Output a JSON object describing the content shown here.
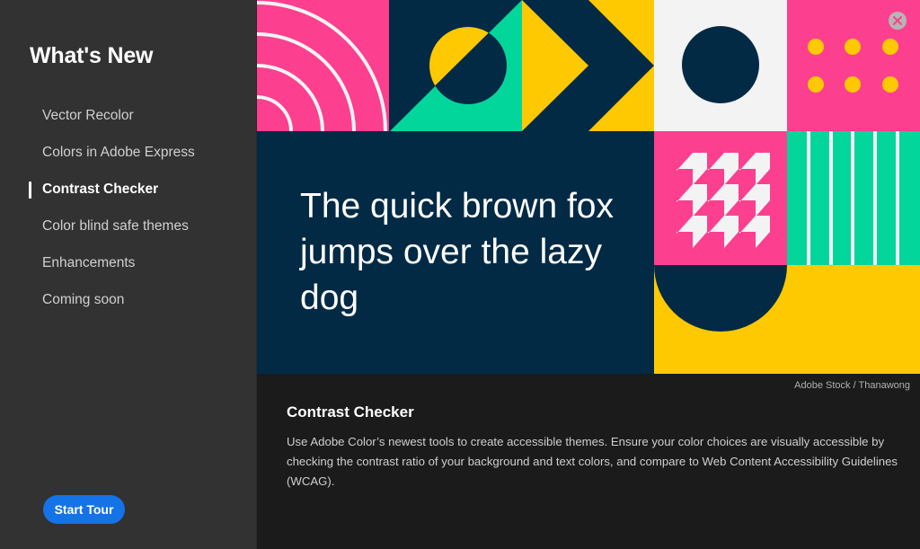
{
  "sidebar": {
    "title": "What's New",
    "items": [
      {
        "label": "Vector Recolor",
        "active": false
      },
      {
        "label": "Colors in Adobe Express",
        "active": false
      },
      {
        "label": "Contrast Checker",
        "active": true
      },
      {
        "label": "Color blind safe themes",
        "active": false
      },
      {
        "label": "Enhancements",
        "active": false
      },
      {
        "label": "Coming soon",
        "active": false
      }
    ],
    "start_tour_label": "Start Tour"
  },
  "hero": {
    "sample_text": "The quick brown fox jumps over the lazy dog",
    "credit": "Adobe Stock / Thanawong",
    "close_icon": "close-icon",
    "colors": {
      "navy": "#032a45",
      "pink": "#fd3f8f",
      "teal": "#03d69b",
      "yellow": "#fec901",
      "white": "#f3f3f3"
    }
  },
  "content": {
    "title": "Contrast Checker",
    "body": "Use Adobe Color’s newest tools to create accessible themes. Ensure your color choices are visually accessible by checking the contrast ratio of your background and text colors, and compare to Web Content Accessibility Guidelines (WCAG)."
  },
  "colors": {
    "accent": "#1473e6",
    "sidebar_bg": "#323232",
    "content_bg": "#1b1b1b"
  }
}
